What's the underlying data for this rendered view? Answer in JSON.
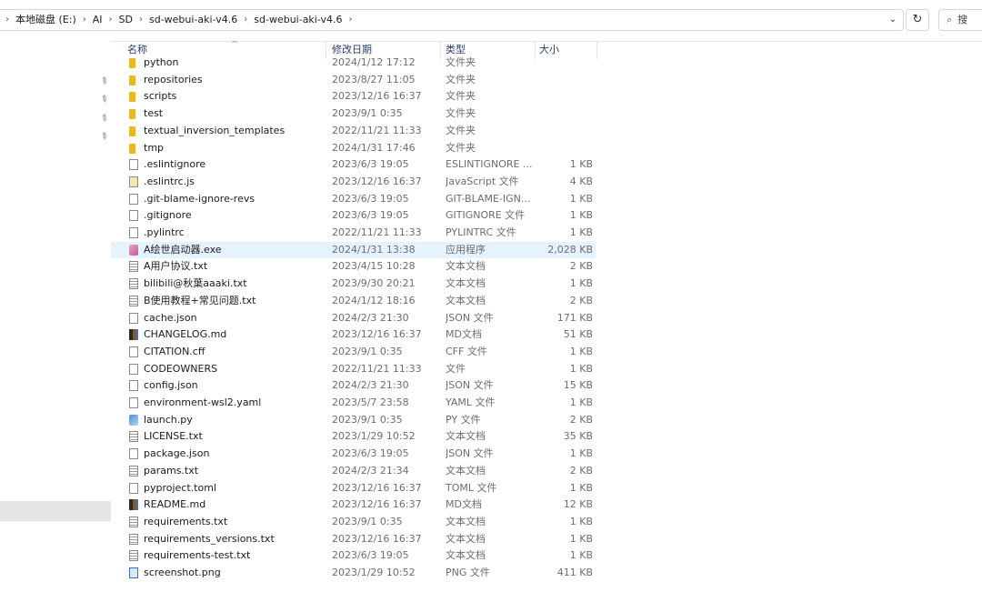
{
  "address_bar": {
    "crumbs": [
      "本地磁盘 (E:)",
      "AI",
      "SD",
      "sd-webui-aki-v4.6",
      "sd-webui-aki-v4.6"
    ],
    "search_placeholder": "搜"
  },
  "columns": {
    "name": "名称",
    "date": "修改日期",
    "type": "类型",
    "size": "大小"
  },
  "files": [
    {
      "name": "python",
      "date": "2024/1/12 17:12",
      "type": "文件夹",
      "size": "",
      "icon": "folder-icon"
    },
    {
      "name": "repositories",
      "date": "2023/8/27 11:05",
      "type": "文件夹",
      "size": "",
      "icon": "folder-icon"
    },
    {
      "name": "scripts",
      "date": "2023/12/16 16:37",
      "type": "文件夹",
      "size": "",
      "icon": "folder-icon"
    },
    {
      "name": "test",
      "date": "2023/9/1 0:35",
      "type": "文件夹",
      "size": "",
      "icon": "folder-icon"
    },
    {
      "name": "textual_inversion_templates",
      "date": "2022/11/21 11:33",
      "type": "文件夹",
      "size": "",
      "icon": "folder-icon"
    },
    {
      "name": "tmp",
      "date": "2024/1/31 17:46",
      "type": "文件夹",
      "size": "",
      "icon": "folder-icon"
    },
    {
      "name": ".eslintignore",
      "date": "2023/6/3 19:05",
      "type": "ESLINTIGNORE ...",
      "size": "1 KB",
      "icon": "file-icon"
    },
    {
      "name": ".eslintrc.js",
      "date": "2023/12/16 16:37",
      "type": "JavaScript 文件",
      "size": "4 KB",
      "icon": "js-file-icon"
    },
    {
      "name": ".git-blame-ignore-revs",
      "date": "2023/6/3 19:05",
      "type": "GIT-BLAME-IGN...",
      "size": "1 KB",
      "icon": "file-icon"
    },
    {
      "name": ".gitignore",
      "date": "2023/6/3 19:05",
      "type": "GITIGNORE 文件",
      "size": "1 KB",
      "icon": "file-icon"
    },
    {
      "name": ".pylintrc",
      "date": "2022/11/21 11:33",
      "type": "PYLINTRC 文件",
      "size": "1 KB",
      "icon": "file-icon"
    },
    {
      "name": "A绘世启动器.exe",
      "date": "2024/1/31 13:38",
      "type": "应用程序",
      "size": "2,028 KB",
      "icon": "exe-icon",
      "selected": true
    },
    {
      "name": "A用户协议.txt",
      "date": "2023/4/15 10:28",
      "type": "文本文档",
      "size": "2 KB",
      "icon": "text-file-icon"
    },
    {
      "name": "bilibili@秋葉aaaki.txt",
      "date": "2023/9/30 20:21",
      "type": "文本文档",
      "size": "1 KB",
      "icon": "text-file-icon"
    },
    {
      "name": "B使用教程+常见问题.txt",
      "date": "2024/1/12 18:16",
      "type": "文本文档",
      "size": "2 KB",
      "icon": "text-file-icon"
    },
    {
      "name": "cache.json",
      "date": "2024/2/3 21:30",
      "type": "JSON 文件",
      "size": "171 KB",
      "icon": "file-icon"
    },
    {
      "name": "CHANGELOG.md",
      "date": "2023/12/16 16:37",
      "type": "MD文档",
      "size": "51 KB",
      "icon": "md-file-icon"
    },
    {
      "name": "CITATION.cff",
      "date": "2023/9/1 0:35",
      "type": "CFF 文件",
      "size": "1 KB",
      "icon": "file-icon"
    },
    {
      "name": "CODEOWNERS",
      "date": "2022/11/21 11:33",
      "type": "文件",
      "size": "1 KB",
      "icon": "file-icon"
    },
    {
      "name": "config.json",
      "date": "2024/2/3 21:30",
      "type": "JSON 文件",
      "size": "15 KB",
      "icon": "file-icon"
    },
    {
      "name": "environment-wsl2.yaml",
      "date": "2023/5/7 23:58",
      "type": "YAML 文件",
      "size": "1 KB",
      "icon": "file-icon"
    },
    {
      "name": "launch.py",
      "date": "2023/9/1 0:35",
      "type": "PY 文件",
      "size": "2 KB",
      "icon": "python-file-icon"
    },
    {
      "name": "LICENSE.txt",
      "date": "2023/1/29 10:52",
      "type": "文本文档",
      "size": "35 KB",
      "icon": "text-file-icon"
    },
    {
      "name": "package.json",
      "date": "2023/6/3 19:05",
      "type": "JSON 文件",
      "size": "1 KB",
      "icon": "file-icon"
    },
    {
      "name": "params.txt",
      "date": "2024/2/3 21:34",
      "type": "文本文档",
      "size": "2 KB",
      "icon": "text-file-icon"
    },
    {
      "name": "pyproject.toml",
      "date": "2023/12/16 16:37",
      "type": "TOML 文件",
      "size": "1 KB",
      "icon": "file-icon"
    },
    {
      "name": "README.md",
      "date": "2023/12/16 16:37",
      "type": "MD文档",
      "size": "12 KB",
      "icon": "md-file-icon"
    },
    {
      "name": "requirements.txt",
      "date": "2023/9/1 0:35",
      "type": "文本文档",
      "size": "1 KB",
      "icon": "text-file-icon"
    },
    {
      "name": "requirements_versions.txt",
      "date": "2023/12/16 16:37",
      "type": "文本文档",
      "size": "1 KB",
      "icon": "text-file-icon"
    },
    {
      "name": "requirements-test.txt",
      "date": "2023/6/3 19:05",
      "type": "文本文档",
      "size": "1 KB",
      "icon": "text-file-icon"
    },
    {
      "name": "screenshot.png",
      "date": "2023/1/29 10:52",
      "type": "PNG 文件",
      "size": "411 KB",
      "icon": "png-file-icon"
    }
  ],
  "colors": {
    "selected_row": "#e5f3ff",
    "folder": "#e8b828",
    "header_text": "#2a3f6d"
  }
}
